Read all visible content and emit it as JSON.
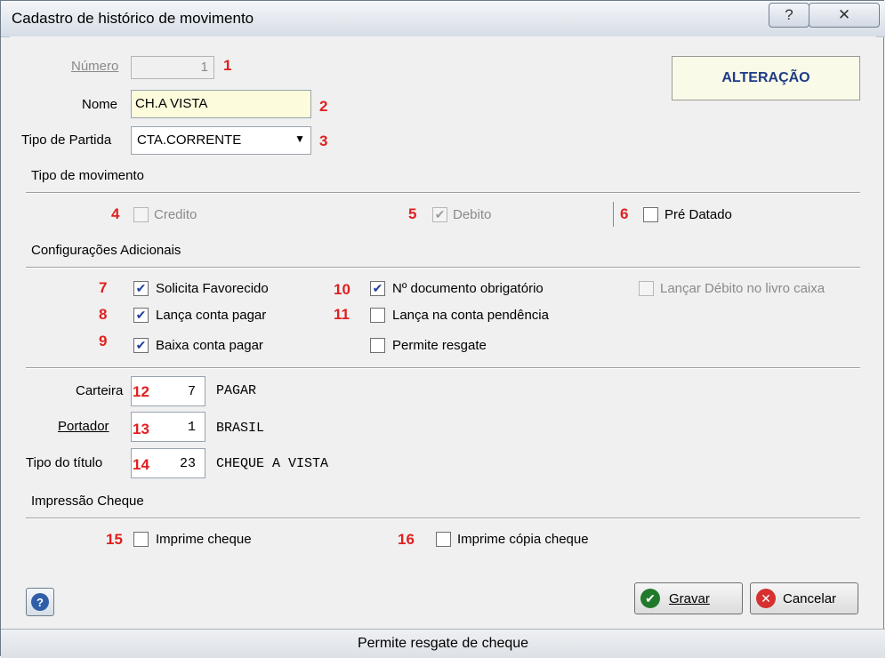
{
  "window": {
    "title": "Cadastro de histórico de movimento",
    "help_glyph": "?",
    "close_glyph": "✕"
  },
  "mode_badge": "ALTERAÇÃO",
  "fields": {
    "numero": {
      "label": "Número",
      "value": "1",
      "marker": "1"
    },
    "nome": {
      "label": "Nome",
      "value": "CH.A VISTA",
      "marker": "2"
    },
    "tipo_partida": {
      "label": "Tipo de Partida",
      "value": "CTA.CORRENTE",
      "marker": "3"
    }
  },
  "tipo_movimento": {
    "header": "Tipo de movimento",
    "credito": {
      "label": "Credito",
      "checked": false,
      "marker": "4"
    },
    "debito": {
      "label": "Debito",
      "checked": true,
      "marker": "5"
    },
    "pre_datado": {
      "label": "Pré Datado",
      "checked": false,
      "marker": "6"
    }
  },
  "config": {
    "header": "Configurações Adicionais",
    "solicita_favorecido": {
      "label": "Solicita Favorecido",
      "checked": true,
      "marker": "7"
    },
    "lanca_conta_pagar": {
      "label": "Lança conta pagar",
      "checked": true,
      "marker": "8"
    },
    "baixa_conta_pagar": {
      "label": "Baixa conta pagar",
      "checked": true,
      "marker": "9"
    },
    "doc_obrigatorio": {
      "label": "Nº documento obrigatório",
      "checked": true,
      "marker": "10"
    },
    "lanca_pendencia": {
      "label": "Lança na conta pendência",
      "checked": false,
      "marker": "11"
    },
    "permite_resgate": {
      "label": "Permite resgate",
      "checked": false
    },
    "lancar_debito_livro": {
      "label": "Lançar Débito no livro caixa",
      "checked": false
    }
  },
  "lookups": {
    "carteira": {
      "label": "Carteira",
      "code": "7",
      "desc": "PAGAR",
      "marker": "12"
    },
    "portador": {
      "label": "Portador",
      "code": "1",
      "desc": "BRASIL",
      "marker": "13"
    },
    "tipo_titulo": {
      "label": "Tipo do título",
      "code": "23",
      "desc": "CHEQUE A VISTA",
      "marker": "14"
    }
  },
  "impressao": {
    "header": "Impressão Cheque",
    "imprime_cheque": {
      "label": "Imprime cheque",
      "checked": false,
      "marker": "15"
    },
    "imprime_copia": {
      "label": "Imprime cópia cheque",
      "checked": false,
      "marker": "16"
    }
  },
  "buttons": {
    "gravar": "Gravar",
    "cancelar": "Cancelar"
  },
  "status": "Permite resgate de cheque"
}
